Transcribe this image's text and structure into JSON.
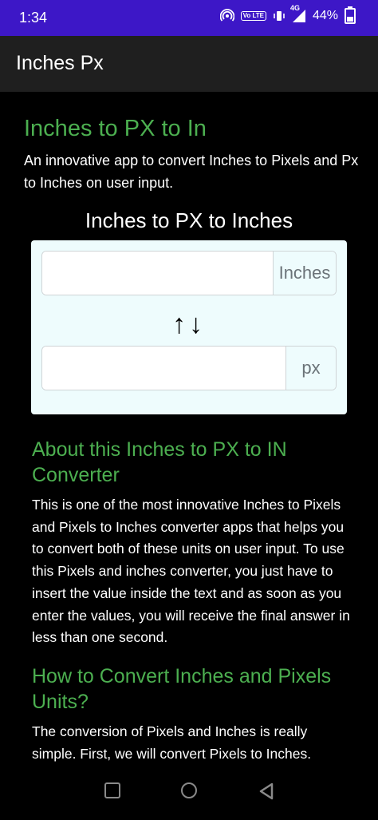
{
  "status": {
    "time": "1:34",
    "network": "4G",
    "battery": "44%",
    "battery_level": 0.44,
    "volte": "Vo LTE"
  },
  "appbar": {
    "title": "Inches Px"
  },
  "page": {
    "heading": "Inches to PX to In",
    "intro": "An innovative app to convert Inches to Pixels and Px to Inches on user input."
  },
  "tool": {
    "title": "Inches to PX to Inches",
    "inches_value": "",
    "inches_unit": "Inches",
    "px_value": "",
    "px_unit": "px",
    "swap_symbol": "↑↓"
  },
  "about": {
    "heading": "About this Inches to PX to IN Converter",
    "text": "This is one of the most innovative Inches to Pixels and Pixels to Inches converter apps that helps you to convert both of these units on user input. To use this Pixels and inches converter, you just have to insert the value inside the text and as soon as you enter the values, you will receive the final answer in less than one second."
  },
  "howto": {
    "heading": "How to Convert Inches and Pixels Units?",
    "text": "The conversion of Pixels and Inches is really simple. First, we will convert Pixels to Inches."
  },
  "icons": {
    "hotspot": "hotspot-icon",
    "volte": "volte-icon",
    "vibrate": "vibrate-icon",
    "signal": "signal-icon",
    "battery": "battery-icon",
    "recents": "recents-icon",
    "home": "home-icon",
    "back": "back-icon"
  }
}
